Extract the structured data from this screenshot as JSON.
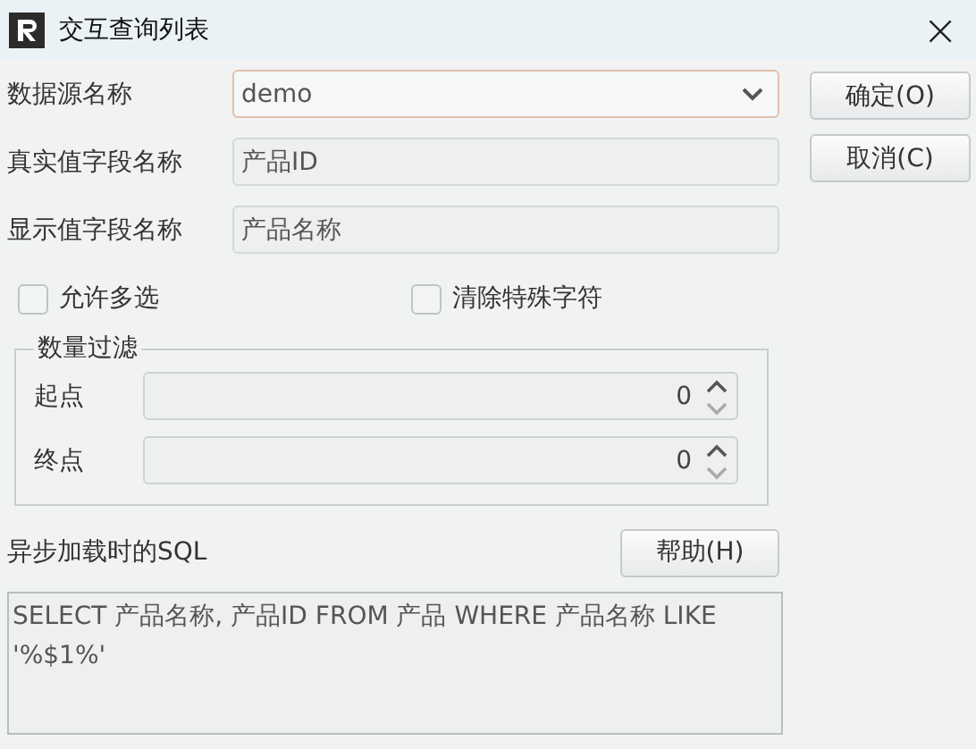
{
  "window": {
    "title": "交互查询列表",
    "close": "×"
  },
  "fields": [
    {
      "kind": "dropdown",
      "label": "数据源名称",
      "value": "demo",
      "focused": true
    },
    {
      "kind": "text",
      "label": "真实值字段名称",
      "value": "产品ID",
      "focused": false
    },
    {
      "kind": "text",
      "label": "显示值字段名称",
      "value": "产品名称",
      "focused": false
    }
  ],
  "buttons": [
    "确定(O)",
    "取消(C)"
  ],
  "checkboxes": [
    {
      "label": "允许多选",
      "checked": false
    },
    {
      "label": "清除特殊字符",
      "checked": false
    }
  ],
  "quantity_filter": {
    "title": "数量过滤",
    "spinners": [
      {
        "label": "起点",
        "value": "0"
      },
      {
        "label": "终点",
        "value": "0"
      }
    ]
  },
  "sql": {
    "label": "异步加载时的SQL",
    "help_button": "帮助(H)",
    "value": "SELECT 产品名称, 产品ID FROM 产品 WHERE 产品名称 LIKE '%$1%'"
  }
}
